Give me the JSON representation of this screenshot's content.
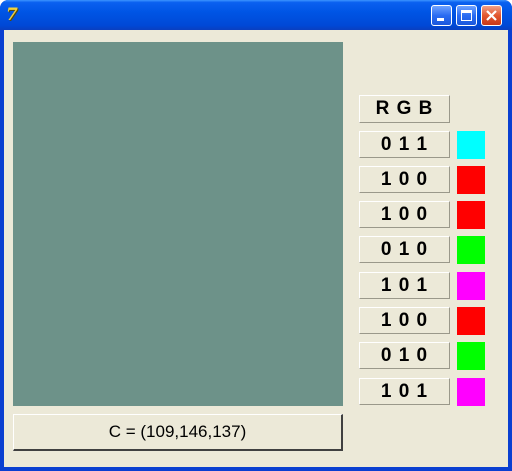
{
  "window": {
    "app_icon_glyph": "7",
    "icon_name": "tk-feather-icon",
    "title_color": "#0055e5"
  },
  "main_swatch": {
    "color": "#6d9289",
    "rgb": [
      109,
      146,
      137
    ]
  },
  "readout": {
    "label": "C = (109,146,137)"
  },
  "rgb_header": {
    "label": "R G B"
  },
  "rows": [
    {
      "label": "0 1 1",
      "color": "#00ffff"
    },
    {
      "label": "1 0 0",
      "color": "#ff0000"
    },
    {
      "label": "1 0 0",
      "color": "#ff0000"
    },
    {
      "label": "0 1 0",
      "color": "#00ff00"
    },
    {
      "label": "1 0 1",
      "color": "#ff00ff"
    },
    {
      "label": "1 0 0",
      "color": "#ff0000"
    },
    {
      "label": "0 1 0",
      "color": "#00ff00"
    },
    {
      "label": "1 0 1",
      "color": "#ff00ff"
    }
  ]
}
